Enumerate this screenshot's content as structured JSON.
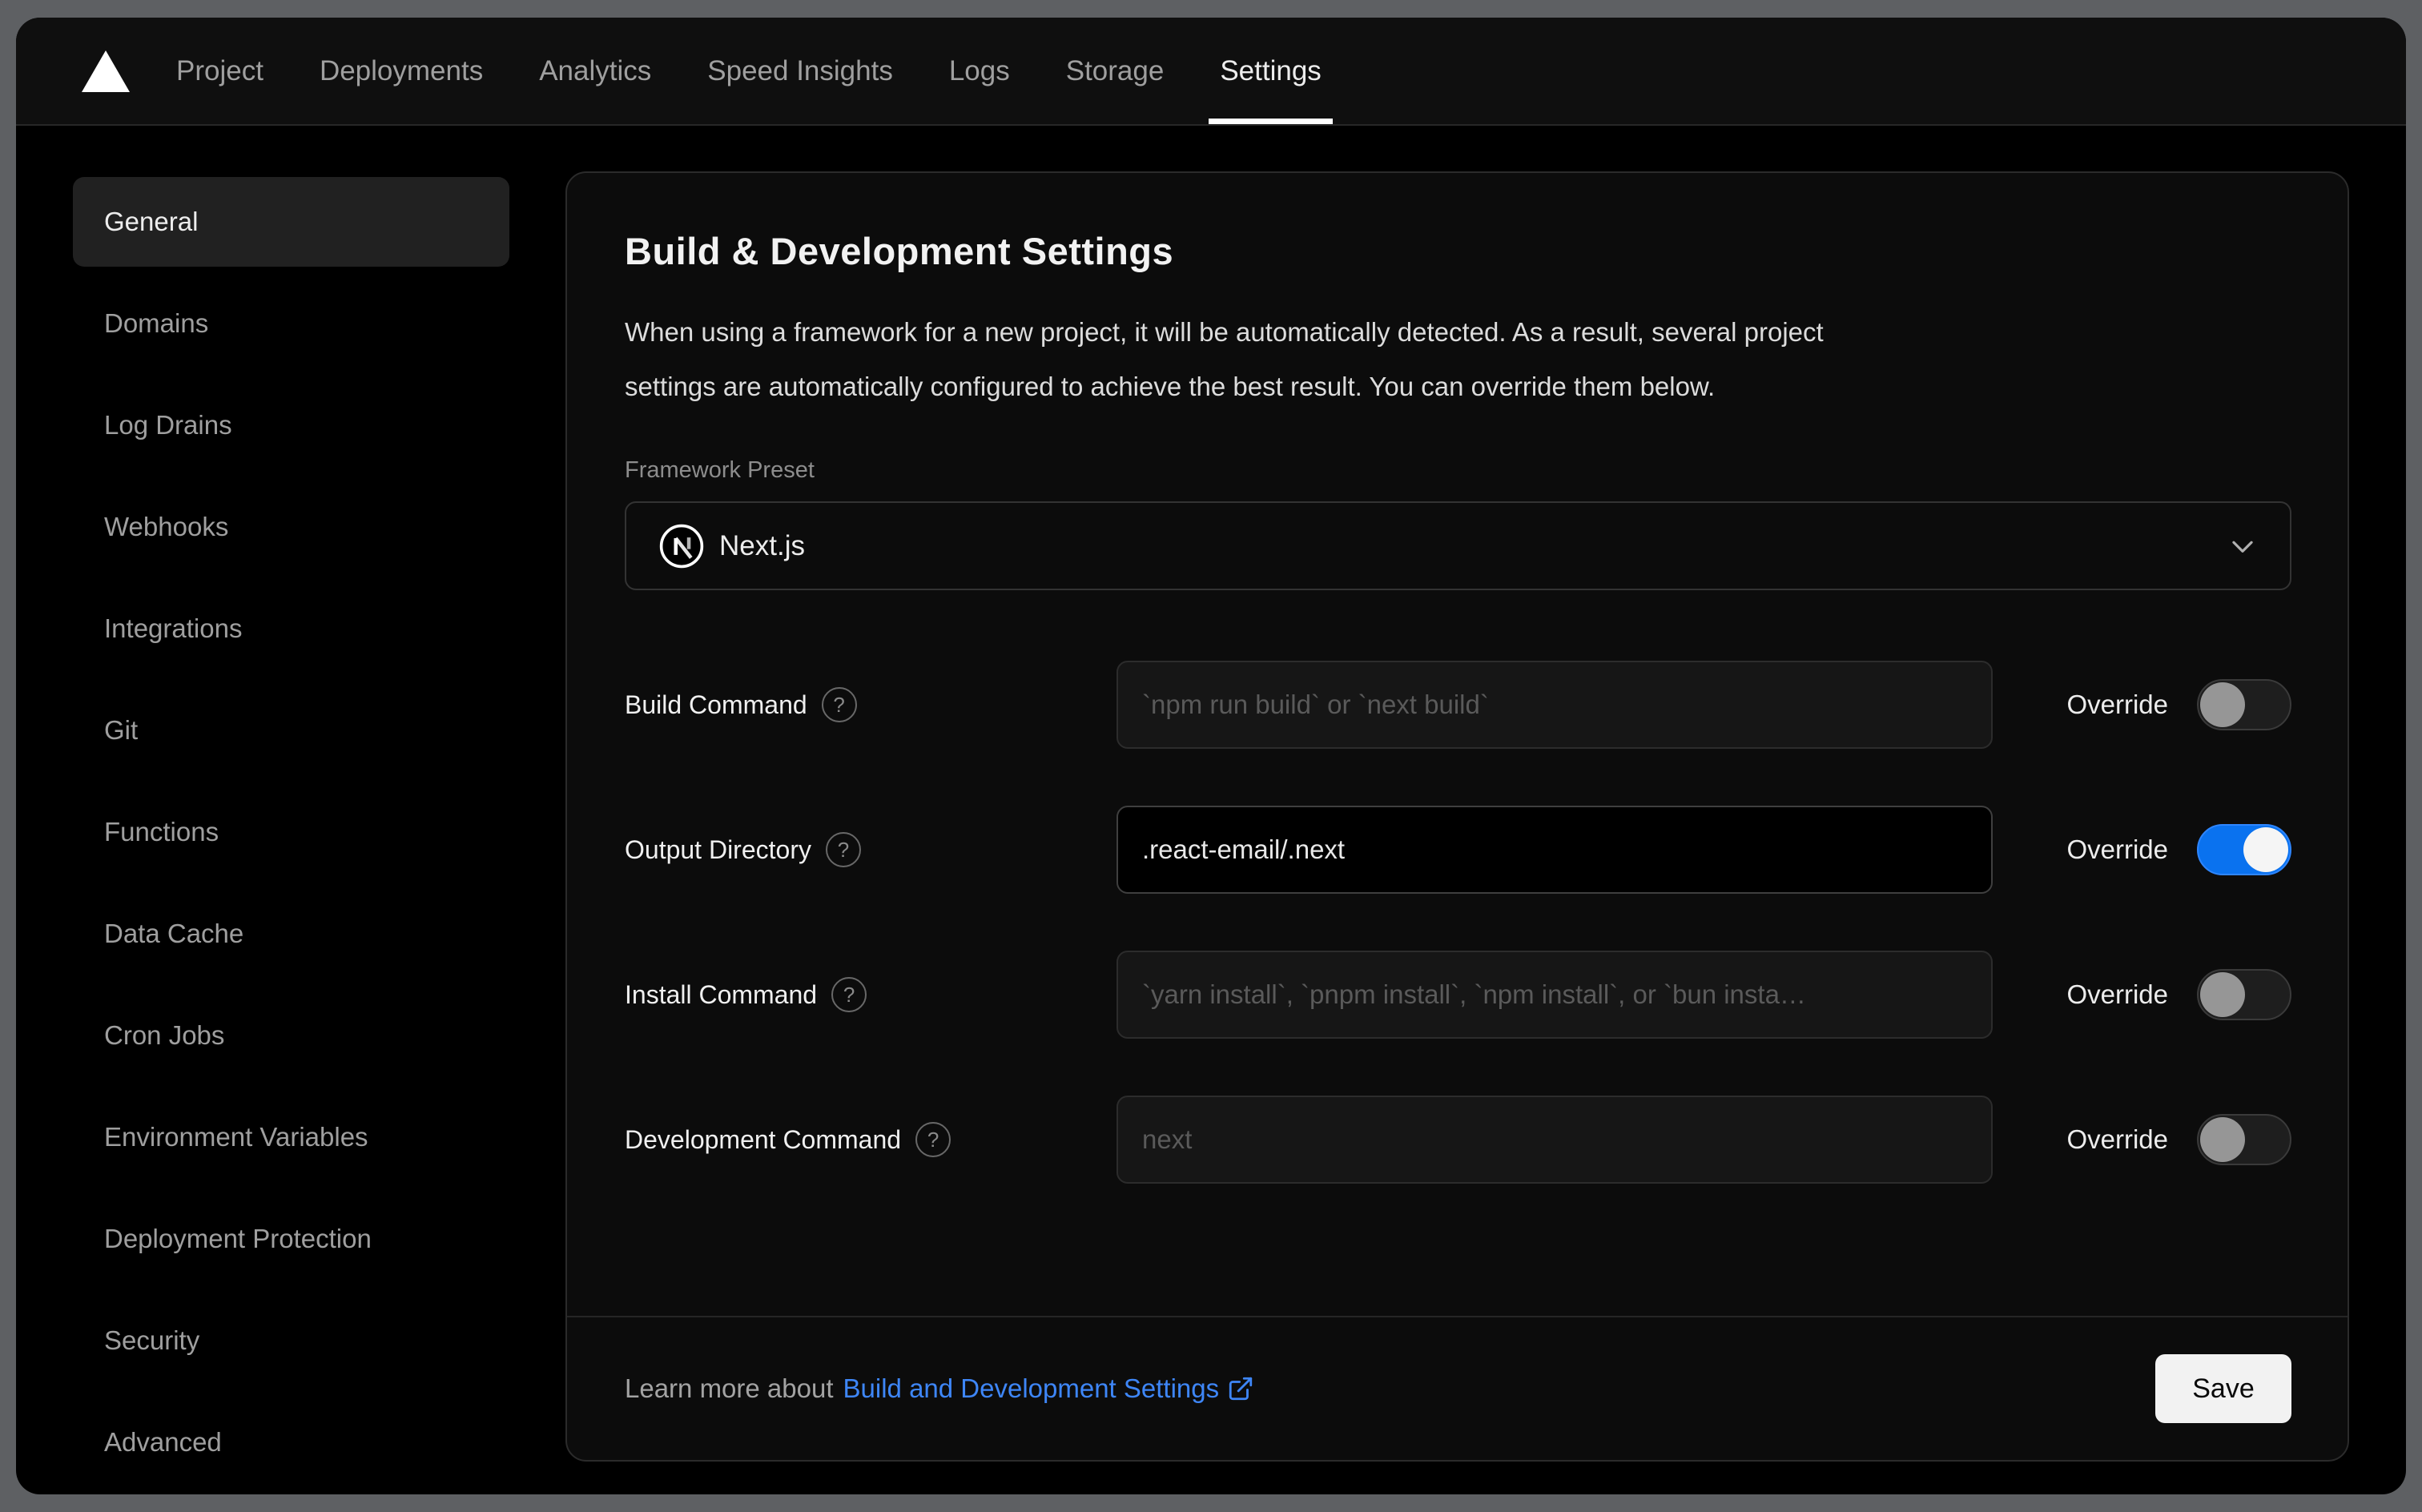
{
  "nav": {
    "tabs": [
      {
        "label": "Project"
      },
      {
        "label": "Deployments"
      },
      {
        "label": "Analytics"
      },
      {
        "label": "Speed Insights"
      },
      {
        "label": "Logs"
      },
      {
        "label": "Storage"
      },
      {
        "label": "Settings"
      }
    ],
    "active_tab": "Settings"
  },
  "sidebar": {
    "active": "General",
    "items": [
      "General",
      "Domains",
      "Log Drains",
      "Webhooks",
      "Integrations",
      "Git",
      "Functions",
      "Data Cache",
      "Cron Jobs",
      "Environment Variables",
      "Deployment Protection",
      "Security",
      "Advanced"
    ]
  },
  "panel": {
    "title": "Build & Development Settings",
    "description_lines": [
      "When using a framework for a new project, it will be automatically detected. As a result, several project",
      "settings are automatically configured to achieve the best result. You can override them below."
    ],
    "framework_preset": {
      "label": "Framework Preset",
      "value": "Next.js"
    },
    "override_label": "Override",
    "rows": [
      {
        "label": "Build Command",
        "placeholder": "`npm run build` or `next build`",
        "value": "",
        "override": false
      },
      {
        "label": "Output Directory",
        "placeholder": "",
        "value": ".react-email/.next",
        "override": true
      },
      {
        "label": "Install Command",
        "placeholder": "`yarn install`, `pnpm install`, `npm install`, or `bun insta…",
        "value": "",
        "override": false
      },
      {
        "label": "Development Command",
        "placeholder": "next",
        "value": "",
        "override": false
      }
    ],
    "footer": {
      "learn_more_prefix": "Learn more about",
      "link_label": "Build and Development Settings",
      "save_label": "Save"
    }
  },
  "colors": {
    "frame_gray": "#5e6063",
    "card_bg": "#0c0c0c",
    "border_gray": "#2b2b2b",
    "toggle_on_blue": "#0a72ef",
    "link_blue": "#3e86f7",
    "active_tab_underline": "#ffffff",
    "save_button_bg": "#f2f2f2"
  }
}
